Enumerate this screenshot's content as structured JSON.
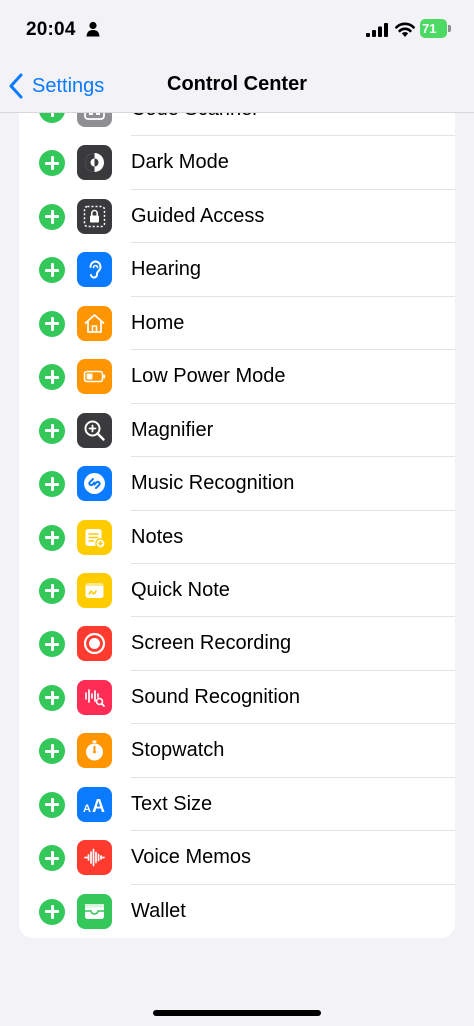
{
  "status_bar": {
    "time": "20:04",
    "battery_percent": "71"
  },
  "nav": {
    "back_label": "Settings",
    "title": "Control Center"
  },
  "rows": [
    {
      "label": "Code Scanner",
      "icon": "qr-code-icon",
      "color": "#8e8e93"
    },
    {
      "label": "Dark Mode",
      "icon": "dark-mode-icon",
      "color": "#3a3a3c"
    },
    {
      "label": "Guided Access",
      "icon": "lock-icon",
      "color": "#3a3a3c"
    },
    {
      "label": "Hearing",
      "icon": "ear-icon",
      "color": "#0a7aff"
    },
    {
      "label": "Home",
      "icon": "house-icon",
      "color": "#ff9500"
    },
    {
      "label": "Low Power Mode",
      "icon": "battery-icon",
      "color": "#ff9500"
    },
    {
      "label": "Magnifier",
      "icon": "magnifier-icon",
      "color": "#3a3a3c"
    },
    {
      "label": "Music Recognition",
      "icon": "shazam-icon",
      "color": "#0a7aff"
    },
    {
      "label": "Notes",
      "icon": "notes-icon",
      "color": "#ffcc00"
    },
    {
      "label": "Quick Note",
      "icon": "quick-note-icon",
      "color": "#ffcc00"
    },
    {
      "label": "Screen Recording",
      "icon": "record-icon",
      "color": "#ff3b30"
    },
    {
      "label": "Sound Recognition",
      "icon": "sound-recognition-icon",
      "color": "#ff2d55"
    },
    {
      "label": "Stopwatch",
      "icon": "stopwatch-icon",
      "color": "#ff9500"
    },
    {
      "label": "Text Size",
      "icon": "text-size-icon",
      "color": "#0a7aff"
    },
    {
      "label": "Voice Memos",
      "icon": "waveform-icon",
      "color": "#ff3b30"
    },
    {
      "label": "Wallet",
      "icon": "wallet-icon",
      "color": "#34c759"
    }
  ]
}
